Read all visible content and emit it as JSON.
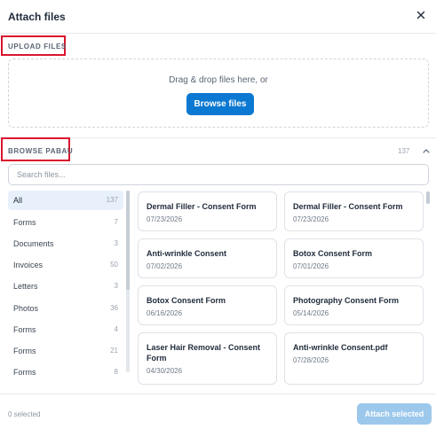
{
  "dialog": {
    "title": "Attach files",
    "close_icon": "close-icon"
  },
  "upload": {
    "section_label": "UPLOAD FILES",
    "drop_text": "Drag & drop files here, or",
    "browse_label": "Browse files"
  },
  "browse": {
    "section_label": "BROWSE PABAU",
    "total_count": "137",
    "search_placeholder": "Search files...",
    "categories": [
      {
        "label": "All",
        "count": "137",
        "active": true
      },
      {
        "label": "Forms",
        "count": "7"
      },
      {
        "label": "Documents",
        "count": "3"
      },
      {
        "label": "Invoices",
        "count": "50"
      },
      {
        "label": "Letters",
        "count": "3"
      },
      {
        "label": "Photos",
        "count": "36"
      },
      {
        "label": "Forms",
        "count": "4"
      },
      {
        "label": "Forms",
        "count": "21"
      },
      {
        "label": "Forms",
        "count": "8"
      }
    ],
    "files": [
      {
        "title": "Dermal Filler - Consent Form",
        "date": "07/23/2026"
      },
      {
        "title": "Dermal Filler - Consent Form",
        "date": "07/23/2026"
      },
      {
        "title": "Anti-wrinkle Consent",
        "date": "07/02/2026"
      },
      {
        "title": "Botox Consent Form",
        "date": "07/01/2026"
      },
      {
        "title": "Botox Consent Form",
        "date": "06/16/2026"
      },
      {
        "title": "Photography Consent Form",
        "date": "05/14/2026"
      },
      {
        "title": "Laser Hair Removal - Consent Form",
        "date": "04/30/2026"
      },
      {
        "title": "Anti-wrinkle Consent.pdf",
        "date": "07/28/2026"
      }
    ]
  },
  "footer": {
    "selected_text": "0 selected",
    "attach_label": "Attach selected"
  },
  "colors": {
    "primary": "#0b78d1",
    "primary_disabled": "#9cc8ec",
    "highlight": "#d9152d"
  }
}
